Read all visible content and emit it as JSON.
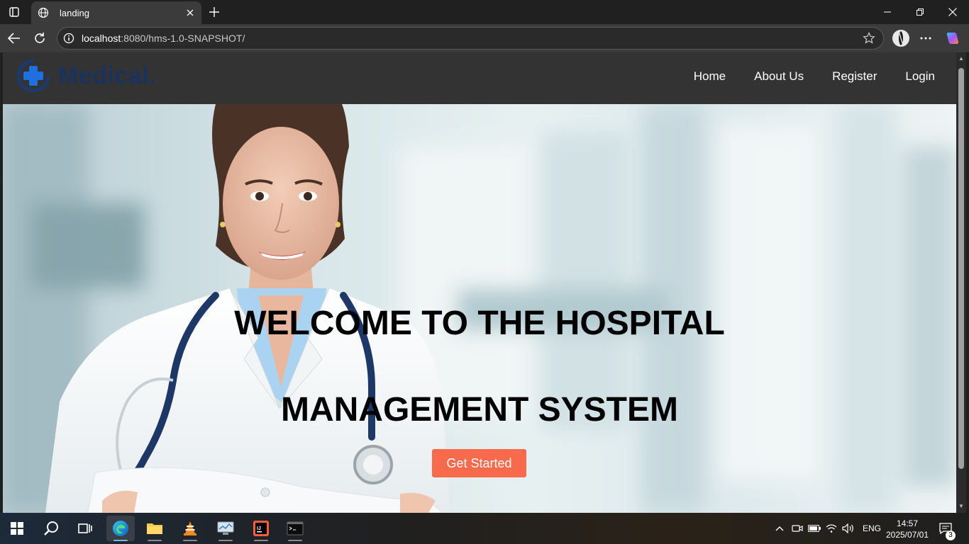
{
  "browser": {
    "tab": {
      "title": "landing"
    },
    "address": {
      "host": "localhost",
      "rest": ":8080/hms-1.0-SNAPSHOT/"
    }
  },
  "site": {
    "logo_text": "Medical.",
    "nav": [
      {
        "label": "Home"
      },
      {
        "label": "About Us"
      },
      {
        "label": "Register"
      },
      {
        "label": "Login"
      }
    ],
    "hero": {
      "line1": "WELCOME TO THE HOSPITAL",
      "line2": "MANAGEMENT SYSTEM",
      "cta": "Get Started"
    }
  },
  "taskbar": {
    "language": "ENG",
    "time": "14:57",
    "date": "2025/07/01",
    "notification_count": "3"
  },
  "colors": {
    "nav_bg": "#333333",
    "logo_blue": "#19335e",
    "cta": "#f76a4c"
  }
}
